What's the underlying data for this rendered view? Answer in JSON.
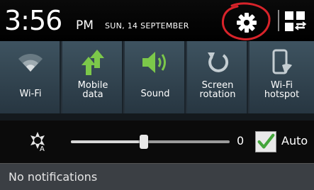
{
  "status": {
    "time": "3:56",
    "ampm": "PM",
    "date": "SUN, 14 SEPTEMBER"
  },
  "annotation_color": "#d8232a",
  "accent_on": "#7cc84a",
  "quick_settings": [
    {
      "id": "wifi",
      "label": "Wi-Fi",
      "icon": "wifi-icon",
      "on": false
    },
    {
      "id": "mobile-data",
      "label": "Mobile data",
      "icon": "mobile-data-icon",
      "on": true
    },
    {
      "id": "sound",
      "label": "Sound",
      "icon": "speaker-icon",
      "on": true
    },
    {
      "id": "screen-rotation",
      "label": "Screen rotation",
      "icon": "rotation-icon",
      "on": false
    },
    {
      "id": "wifi-hotspot",
      "label": "Wi-Fi hotspot",
      "icon": "hotspot-icon",
      "on": false
    }
  ],
  "brightness": {
    "value": "0",
    "level": 0.46,
    "auto_label": "Auto",
    "auto_checked": true
  },
  "notifications": {
    "empty_text": "No notifications"
  }
}
